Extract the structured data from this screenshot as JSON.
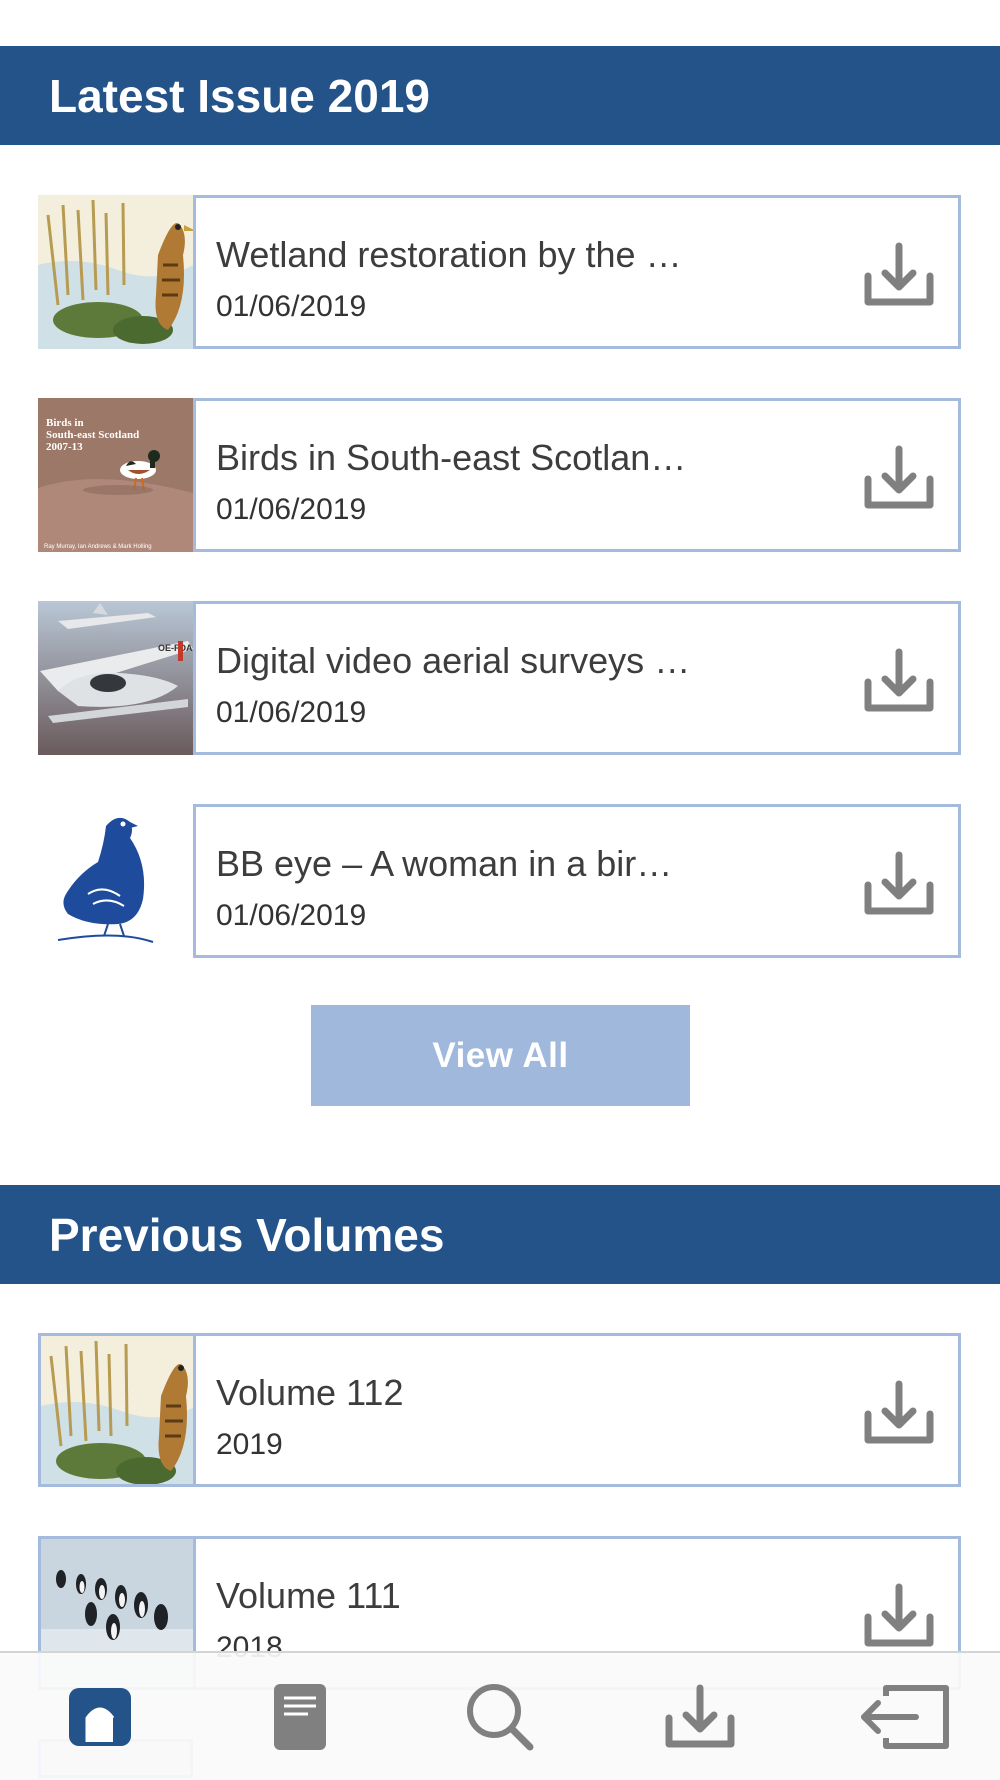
{
  "sections": {
    "latest_title": "Latest Issue 2019",
    "previous_title": "Previous Volumes"
  },
  "latest": [
    {
      "title": "Wetland restoration by the …",
      "date": "01/06/2019",
      "thumb": "bittern-painting"
    },
    {
      "title": "Birds in South-east Scotlan…",
      "date": "01/06/2019",
      "thumb": "book-cover-shelduck"
    },
    {
      "title": "Digital video aerial surveys …",
      "date": "01/06/2019",
      "thumb": "aircraft-photo"
    },
    {
      "title": "BB eye – A woman in a bir…",
      "date": "01/06/2019",
      "thumb": "grouse-logo"
    }
  ],
  "thumb_text": {
    "book_title": "Birds in\nSouth-east Scotland\n2007-13",
    "book_authors": "Ray Murray, Ian Andrews & Mark Holling",
    "plane_reg": "OE-FDA"
  },
  "view_all_label": "View All",
  "volumes": [
    {
      "title": "Volume 112",
      "year": "2019",
      "thumb": "bittern-painting"
    },
    {
      "title": "Volume 111",
      "year": "2018",
      "thumb": "penguins-photo"
    }
  ],
  "tabs": [
    {
      "name": "home",
      "icon": "home-icon",
      "active": true
    },
    {
      "name": "articles",
      "icon": "document-icon",
      "active": false
    },
    {
      "name": "search",
      "icon": "search-icon",
      "active": false
    },
    {
      "name": "downloads",
      "icon": "download-icon",
      "active": false
    },
    {
      "name": "logout",
      "icon": "logout-icon",
      "active": false
    }
  ],
  "colors": {
    "header": "#245389",
    "card_border": "#a4bbdd",
    "button": "#9fb8db",
    "icon_grey": "#808080",
    "active_tab": "#245389"
  }
}
